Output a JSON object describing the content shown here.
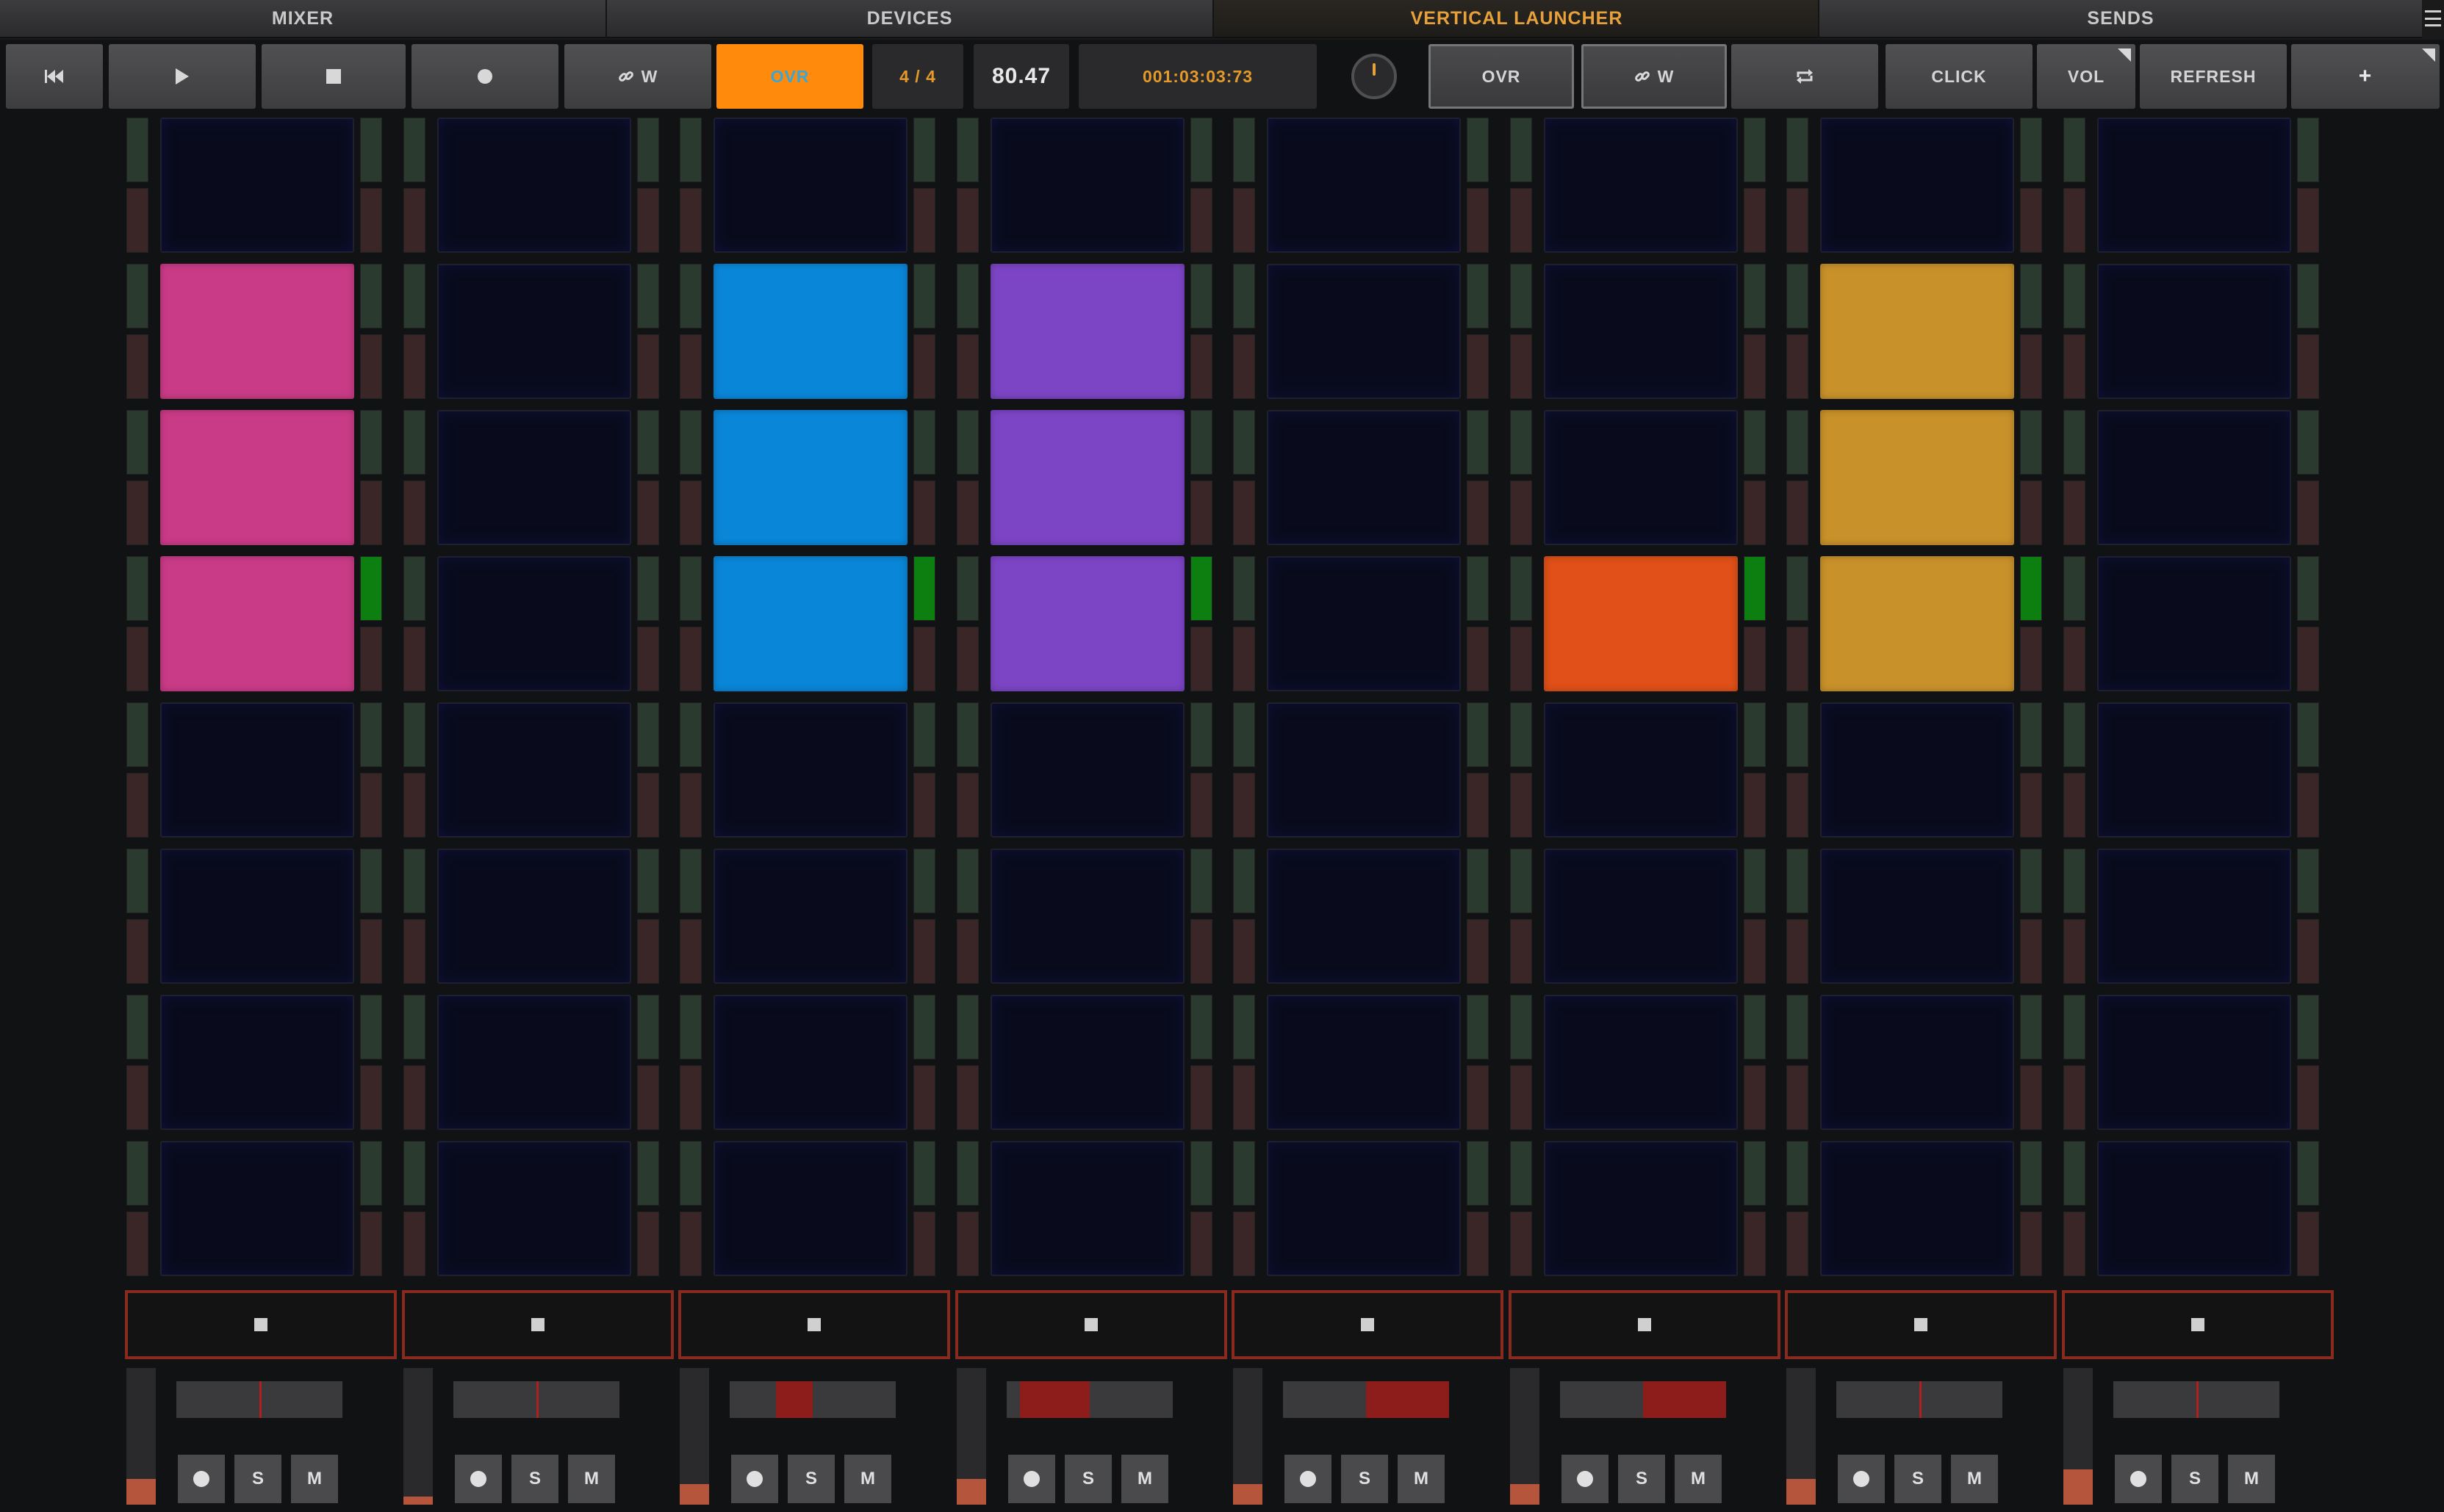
{
  "tabs": [
    {
      "label": "MIXER",
      "active": false
    },
    {
      "label": "DEVICES",
      "active": false
    },
    {
      "label": "VERTICAL LAUNCHER",
      "active": true
    },
    {
      "label": "SENDS",
      "active": false
    }
  ],
  "toolbar": {
    "link_w_label": "W",
    "ovr_active_label": "OVR",
    "time_signature": "4 / 4",
    "tempo": "80.47",
    "position": "001:03:03:73",
    "ovr_label": "OVR",
    "link_w2_label": "W",
    "click_label": "CLICK",
    "vol_label": "VOL",
    "refresh_label": "REFRESH",
    "add_label": "+"
  },
  "colors": {
    "accent": "#e8a13a",
    "ovr_active_bg": "#ff8a0b",
    "empty_clip": "#090b1d",
    "meter_active": "#0c7f10",
    "stop_border": "#8a2a1e"
  },
  "tracks": [
    {
      "clips": [
        null,
        "#c93b86",
        "#c93b86",
        "#c93b86",
        null,
        null,
        null,
        null
      ],
      "active_meter_row": 3,
      "volume": 0.19,
      "pan_fill": null,
      "pan_line": 0.5,
      "buttons": [
        "",
        "S",
        "M"
      ]
    },
    {
      "clips": [
        null,
        null,
        null,
        null,
        null,
        null,
        null,
        null
      ],
      "active_meter_row": null,
      "volume": 0.06,
      "pan_fill": null,
      "pan_line": 0.5,
      "buttons": [
        "",
        "S",
        "M"
      ]
    },
    {
      "clips": [
        null,
        "#0a86d8",
        "#0a86d8",
        "#0a86d8",
        null,
        null,
        null,
        null
      ],
      "active_meter_row": 3,
      "volume": 0.15,
      "pan_fill": [
        0.28,
        0.5
      ],
      "pan_line": null,
      "buttons": [
        "",
        "S",
        "M"
      ]
    },
    {
      "clips": [
        null,
        "#7c45c5",
        "#7c45c5",
        "#7c45c5",
        null,
        null,
        null,
        null
      ],
      "active_meter_row": 3,
      "volume": 0.19,
      "pan_fill": [
        0.08,
        0.5
      ],
      "pan_line": null,
      "buttons": [
        "",
        "S",
        "M"
      ]
    },
    {
      "clips": [
        null,
        null,
        null,
        null,
        null,
        null,
        null,
        null
      ],
      "active_meter_row": null,
      "volume": 0.15,
      "pan_fill": [
        0.5,
        1.0
      ],
      "pan_line": null,
      "buttons": [
        "",
        "S",
        "M"
      ]
    },
    {
      "clips": [
        null,
        null,
        null,
        "#e05018",
        null,
        null,
        null,
        null
      ],
      "active_meter_row": 3,
      "volume": 0.15,
      "pan_fill": [
        0.5,
        1.0
      ],
      "pan_line": null,
      "buttons": [
        "",
        "S",
        "M"
      ]
    },
    {
      "clips": [
        null,
        "#c9912a",
        "#c9912a",
        "#c9912a",
        null,
        null,
        null,
        null
      ],
      "active_meter_row": 3,
      "volume": 0.19,
      "pan_fill": null,
      "pan_line": 0.5,
      "buttons": [
        "",
        "S",
        "M"
      ]
    },
    {
      "clips": [
        null,
        null,
        null,
        null,
        null,
        null,
        null,
        null
      ],
      "active_meter_row": null,
      "volume": 0.26,
      "pan_fill": null,
      "pan_line": 0.5,
      "buttons": [
        "",
        "S",
        "M"
      ]
    }
  ]
}
